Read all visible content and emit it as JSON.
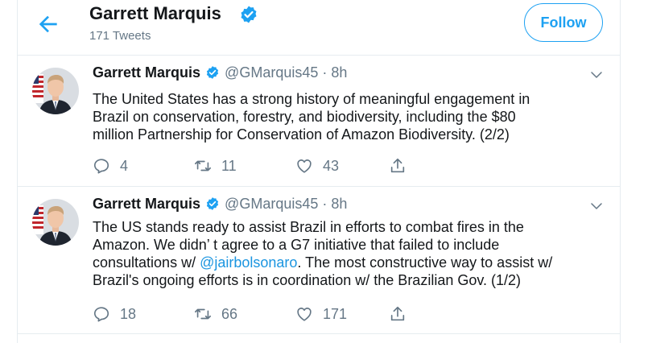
{
  "header": {
    "name": "Garrett Marquis",
    "tweet_count": "171 Tweets",
    "follow_label": "Follow"
  },
  "icons": {
    "back": "back-arrow-icon",
    "verified": "verified-badge-icon",
    "caret": "chevron-down-icon",
    "reply": "reply-icon",
    "retweet": "retweet-icon",
    "like": "heart-icon",
    "share": "share-icon"
  },
  "colors": {
    "accent": "#1da1f2",
    "mention": "#1b95e0",
    "muted": "#657786",
    "text": "#14171a"
  },
  "tweets": [
    {
      "name": "Garrett Marquis",
      "handle": "@GMarquis45",
      "dot": "·",
      "time": "8h",
      "lines": [
        "The United States has a strong history of meaningful engagement in",
        "Brazil on conservation, forestry, and biodiversity, including the $80",
        "million Partnership for Conservation of Amazon Biodiversity. (2/2)"
      ],
      "replies": "4",
      "retweets": "11",
      "likes": "43"
    },
    {
      "name": "Garrett Marquis",
      "handle": "@GMarquis45",
      "dot": "·",
      "time": "8h",
      "line1": "The US stands ready to assist Brazil in efforts to combat fires in the",
      "line2": "Amazon. We didn’ t agree to a G7 initiative that failed to include",
      "line3_pre": "consultations w/ ",
      "line3_mention": "@jairbolsonaro",
      "line3_post": ". The most constructive way to assist w/",
      "line4": "Brazil's ongoing efforts is in coordination w/ the Brazilian Gov. (1/2)",
      "replies": "18",
      "retweets": "66",
      "likes": "171"
    }
  ]
}
